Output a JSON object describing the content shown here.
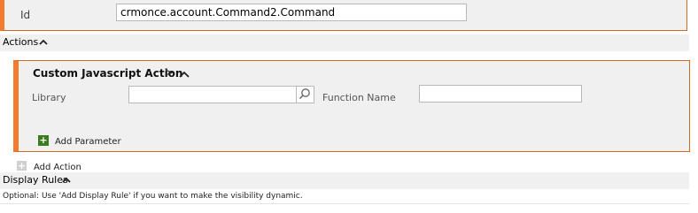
{
  "id_field": {
    "label": "Id",
    "value": "crmonce.account.Command2.Command"
  },
  "actions_section": {
    "header": "Actions",
    "card": {
      "title": "Custom Javascript Action",
      "expand_symbol": ">",
      "library_label": "Library",
      "library_value": "",
      "function_name_label": "Function Name",
      "function_name_value": "",
      "add_parameter_label": "Add Parameter"
    },
    "add_action_label": "Add Action"
  },
  "display_rules_section": {
    "header": "Display Rules",
    "help_text": "Optional: Use 'Add Display Rule' if you want to make the visibility dynamic."
  },
  "colors": {
    "accent": "#f47a2e",
    "panel_bg": "#f0f0f0",
    "add_green": "#3b7d1e"
  },
  "icons": [
    "chevron-up-icon",
    "search-icon",
    "plus-icon"
  ]
}
